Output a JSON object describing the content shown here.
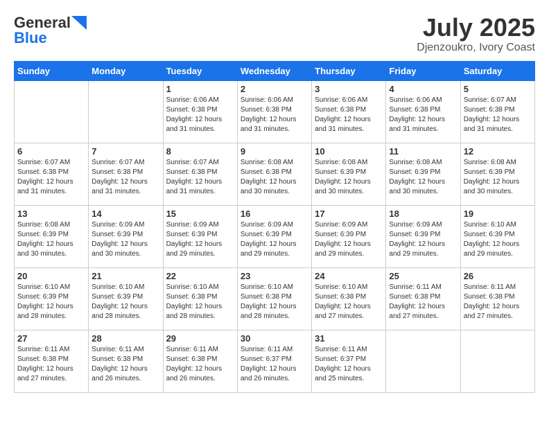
{
  "header": {
    "logo_general": "General",
    "logo_blue": "Blue",
    "title": "July 2025",
    "subtitle": "Djenzoukro, Ivory Coast"
  },
  "calendar": {
    "days_of_week": [
      "Sunday",
      "Monday",
      "Tuesday",
      "Wednesday",
      "Thursday",
      "Friday",
      "Saturday"
    ],
    "weeks": [
      [
        {
          "day": "",
          "info": ""
        },
        {
          "day": "",
          "info": ""
        },
        {
          "day": "1",
          "info": "Sunrise: 6:06 AM\nSunset: 6:38 PM\nDaylight: 12 hours and 31 minutes."
        },
        {
          "day": "2",
          "info": "Sunrise: 6:06 AM\nSunset: 6:38 PM\nDaylight: 12 hours and 31 minutes."
        },
        {
          "day": "3",
          "info": "Sunrise: 6:06 AM\nSunset: 6:38 PM\nDaylight: 12 hours and 31 minutes."
        },
        {
          "day": "4",
          "info": "Sunrise: 6:06 AM\nSunset: 6:38 PM\nDaylight: 12 hours and 31 minutes."
        },
        {
          "day": "5",
          "info": "Sunrise: 6:07 AM\nSunset: 6:38 PM\nDaylight: 12 hours and 31 minutes."
        }
      ],
      [
        {
          "day": "6",
          "info": "Sunrise: 6:07 AM\nSunset: 6:38 PM\nDaylight: 12 hours and 31 minutes."
        },
        {
          "day": "7",
          "info": "Sunrise: 6:07 AM\nSunset: 6:38 PM\nDaylight: 12 hours and 31 minutes."
        },
        {
          "day": "8",
          "info": "Sunrise: 6:07 AM\nSunset: 6:38 PM\nDaylight: 12 hours and 31 minutes."
        },
        {
          "day": "9",
          "info": "Sunrise: 6:08 AM\nSunset: 6:38 PM\nDaylight: 12 hours and 30 minutes."
        },
        {
          "day": "10",
          "info": "Sunrise: 6:08 AM\nSunset: 6:39 PM\nDaylight: 12 hours and 30 minutes."
        },
        {
          "day": "11",
          "info": "Sunrise: 6:08 AM\nSunset: 6:39 PM\nDaylight: 12 hours and 30 minutes."
        },
        {
          "day": "12",
          "info": "Sunrise: 6:08 AM\nSunset: 6:39 PM\nDaylight: 12 hours and 30 minutes."
        }
      ],
      [
        {
          "day": "13",
          "info": "Sunrise: 6:08 AM\nSunset: 6:39 PM\nDaylight: 12 hours and 30 minutes."
        },
        {
          "day": "14",
          "info": "Sunrise: 6:09 AM\nSunset: 6:39 PM\nDaylight: 12 hours and 30 minutes."
        },
        {
          "day": "15",
          "info": "Sunrise: 6:09 AM\nSunset: 6:39 PM\nDaylight: 12 hours and 29 minutes."
        },
        {
          "day": "16",
          "info": "Sunrise: 6:09 AM\nSunset: 6:39 PM\nDaylight: 12 hours and 29 minutes."
        },
        {
          "day": "17",
          "info": "Sunrise: 6:09 AM\nSunset: 6:39 PM\nDaylight: 12 hours and 29 minutes."
        },
        {
          "day": "18",
          "info": "Sunrise: 6:09 AM\nSunset: 6:39 PM\nDaylight: 12 hours and 29 minutes."
        },
        {
          "day": "19",
          "info": "Sunrise: 6:10 AM\nSunset: 6:39 PM\nDaylight: 12 hours and 29 minutes."
        }
      ],
      [
        {
          "day": "20",
          "info": "Sunrise: 6:10 AM\nSunset: 6:39 PM\nDaylight: 12 hours and 28 minutes."
        },
        {
          "day": "21",
          "info": "Sunrise: 6:10 AM\nSunset: 6:39 PM\nDaylight: 12 hours and 28 minutes."
        },
        {
          "day": "22",
          "info": "Sunrise: 6:10 AM\nSunset: 6:38 PM\nDaylight: 12 hours and 28 minutes."
        },
        {
          "day": "23",
          "info": "Sunrise: 6:10 AM\nSunset: 6:38 PM\nDaylight: 12 hours and 28 minutes."
        },
        {
          "day": "24",
          "info": "Sunrise: 6:10 AM\nSunset: 6:38 PM\nDaylight: 12 hours and 27 minutes."
        },
        {
          "day": "25",
          "info": "Sunrise: 6:11 AM\nSunset: 6:38 PM\nDaylight: 12 hours and 27 minutes."
        },
        {
          "day": "26",
          "info": "Sunrise: 6:11 AM\nSunset: 6:38 PM\nDaylight: 12 hours and 27 minutes."
        }
      ],
      [
        {
          "day": "27",
          "info": "Sunrise: 6:11 AM\nSunset: 6:38 PM\nDaylight: 12 hours and 27 minutes."
        },
        {
          "day": "28",
          "info": "Sunrise: 6:11 AM\nSunset: 6:38 PM\nDaylight: 12 hours and 26 minutes."
        },
        {
          "day": "29",
          "info": "Sunrise: 6:11 AM\nSunset: 6:38 PM\nDaylight: 12 hours and 26 minutes."
        },
        {
          "day": "30",
          "info": "Sunrise: 6:11 AM\nSunset: 6:37 PM\nDaylight: 12 hours and 26 minutes."
        },
        {
          "day": "31",
          "info": "Sunrise: 6:11 AM\nSunset: 6:37 PM\nDaylight: 12 hours and 25 minutes."
        },
        {
          "day": "",
          "info": ""
        },
        {
          "day": "",
          "info": ""
        }
      ]
    ]
  }
}
